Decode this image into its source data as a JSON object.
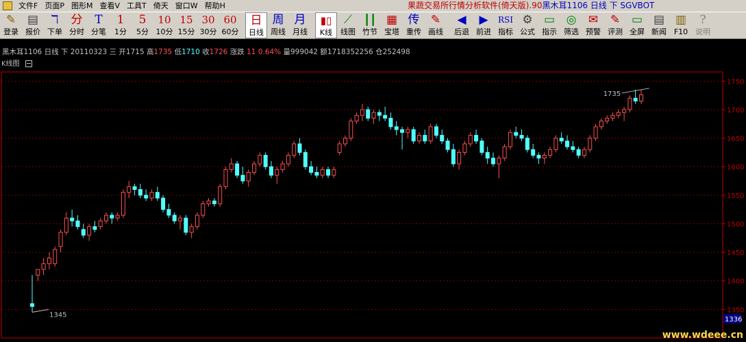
{
  "menu": {
    "items": [
      {
        "label": "文件F",
        "name": "menu-file"
      },
      {
        "label": "页面P",
        "name": "menu-page"
      },
      {
        "label": "图形M",
        "name": "menu-graph"
      },
      {
        "label": "查看V",
        "name": "menu-view"
      },
      {
        "label": "工具T",
        "name": "menu-tools"
      },
      {
        "label": "倚天",
        "name": "menu-yitian"
      },
      {
        "label": "窗口W",
        "name": "menu-window"
      },
      {
        "label": "帮助H",
        "name": "menu-help"
      }
    ],
    "title_prefix": "果蔬交易所行情分析软件(倚天版).90",
    "title_symbol": "黑木耳1106 日线 下 SGVBOT"
  },
  "toolbar": [
    {
      "icon": "✎",
      "label": "登录",
      "name": "login-button",
      "color": "#806000"
    },
    {
      "icon": "▤",
      "label": "报价",
      "name": "quote-button",
      "color": "#404040"
    },
    {
      "icon": "ℸ",
      "label": "下单",
      "name": "order-button",
      "color": "#0000c0"
    },
    {
      "icon": "分",
      "label": "分时",
      "name": "timeshare-button",
      "color": "#c00000"
    },
    {
      "icon": "T",
      "label": "分笔",
      "name": "tick-button",
      "color": "#0000c0"
    },
    {
      "icon": "1",
      "label": "1分",
      "name": "1min-button",
      "color": "#c00000"
    },
    {
      "icon": "5",
      "label": "5分",
      "name": "5min-button",
      "color": "#c00000"
    },
    {
      "icon": "10",
      "label": "10分",
      "name": "10min-button",
      "color": "#c00000"
    },
    {
      "icon": "15",
      "label": "15分",
      "name": "15min-button",
      "color": "#c00000"
    },
    {
      "icon": "30",
      "label": "30分",
      "name": "30min-button",
      "color": "#c00000"
    },
    {
      "icon": "60",
      "label": "60分",
      "name": "60min-button",
      "color": "#c00000"
    },
    {
      "icon": "日",
      "label": "日线",
      "name": "daily-button",
      "color": "#c00000",
      "active": true
    },
    {
      "icon": "周",
      "label": "周线",
      "name": "weekly-button",
      "color": "#0000c0"
    },
    {
      "icon": "月",
      "label": "月线",
      "name": "monthly-button",
      "color": "#0000c0"
    },
    {
      "icon": "▮▯",
      "label": "K线",
      "name": "kline-button",
      "color": "#c00000",
      "active": true
    },
    {
      "icon": "⟋",
      "label": "线图",
      "name": "linechart-button",
      "color": "#008000"
    },
    {
      "icon": "┃┃",
      "label": "竹节",
      "name": "bamboo-button",
      "color": "#008000"
    },
    {
      "icon": "▦",
      "label": "宝塔",
      "name": "pagoda-button",
      "color": "#c00000"
    },
    {
      "icon": "传",
      "label": "重传",
      "name": "reload-button",
      "color": "#0000c0"
    },
    {
      "icon": "✎",
      "label": "画线",
      "name": "draw-line-button",
      "color": "#c00000"
    },
    {
      "icon": "◀",
      "label": "后退",
      "name": "back-button",
      "color": "#0000c0"
    },
    {
      "icon": "▶",
      "label": "前进",
      "name": "forward-button",
      "color": "#0000c0"
    },
    {
      "icon": "RSI",
      "label": "指标",
      "name": "indicator-button",
      "color": "#0000c0"
    },
    {
      "icon": "⚙",
      "label": "公式",
      "name": "formula-button",
      "color": "#404040"
    },
    {
      "icon": "▭",
      "label": "指示",
      "name": "indicate-button",
      "color": "#008000"
    },
    {
      "icon": "◎",
      "label": "筛选",
      "name": "filter-button",
      "color": "#008000"
    },
    {
      "icon": "✉",
      "label": "预警",
      "name": "alert-button",
      "color": "#c00000"
    },
    {
      "icon": "✎",
      "label": "评测",
      "name": "evaluate-button",
      "color": "#c00000"
    },
    {
      "icon": "▭",
      "label": "全屏",
      "name": "fullscreen-button",
      "color": "#008000"
    },
    {
      "icon": "▤",
      "label": "新闻",
      "name": "news-button",
      "color": "#404040"
    },
    {
      "icon": "▥",
      "label": "F10",
      "name": "f10-button",
      "color": "#806000"
    },
    {
      "icon": "?",
      "label": "说明",
      "name": "help-button",
      "color": "#808080",
      "disabled": true
    }
  ],
  "info": {
    "symbol": "黑木耳1106",
    "period": "日线",
    "type": "下",
    "date": "20110323",
    "weekday": "三",
    "open_label": "开",
    "open": "1715",
    "high_label": "高",
    "high": "1735",
    "low_label": "低",
    "low": "1710",
    "close_label": "收",
    "close": "1726",
    "change_label": "涨跌",
    "change": "11",
    "change_pct": "0.64%",
    "volume_label": "量",
    "volume": "999042",
    "amount_label": "额",
    "amount": "1718352256",
    "oi_label": "仓",
    "oi": "252498"
  },
  "panel": {
    "title": "K线图"
  },
  "colors": {
    "up": "#ff5050",
    "down": "#50ffff",
    "grid": "#800000",
    "axis": "#c00000",
    "label": "#c0c0c0"
  },
  "chart_data": {
    "type": "candlestick",
    "ylim": [
      1336,
      1766
    ],
    "yticks": [
      1350,
      1400,
      1450,
      1500,
      1550,
      1600,
      1650,
      1700,
      1750
    ],
    "annotations": [
      {
        "text": "1345",
        "value": 1345
      },
      {
        "text": "1735",
        "value": 1735
      }
    ],
    "cursor_label": "1336",
    "candles": [
      [
        1360,
        1410,
        1345,
        1355
      ],
      [
        1410,
        1420,
        1400,
        1420
      ],
      [
        1420,
        1440,
        1410,
        1430
      ],
      [
        1430,
        1450,
        1420,
        1440
      ],
      [
        1430,
        1460,
        1425,
        1455
      ],
      [
        1460,
        1490,
        1450,
        1485
      ],
      [
        1485,
        1520,
        1480,
        1510
      ],
      [
        1510,
        1525,
        1495,
        1505
      ],
      [
        1505,
        1515,
        1490,
        1495
      ],
      [
        1490,
        1500,
        1475,
        1480
      ],
      [
        1480,
        1500,
        1470,
        1495
      ],
      [
        1495,
        1505,
        1485,
        1490
      ],
      [
        1495,
        1510,
        1490,
        1505
      ],
      [
        1505,
        1520,
        1500,
        1515
      ],
      [
        1515,
        1520,
        1500,
        1510
      ],
      [
        1510,
        1520,
        1505,
        1515
      ],
      [
        1515,
        1560,
        1510,
        1555
      ],
      [
        1555,
        1575,
        1545,
        1565
      ],
      [
        1565,
        1570,
        1550,
        1560
      ],
      [
        1560,
        1570,
        1545,
        1550
      ],
      [
        1550,
        1560,
        1540,
        1545
      ],
      [
        1545,
        1560,
        1540,
        1555
      ],
      [
        1555,
        1565,
        1540,
        1545
      ],
      [
        1545,
        1550,
        1520,
        1525
      ],
      [
        1525,
        1535,
        1510,
        1515
      ],
      [
        1515,
        1520,
        1500,
        1505
      ],
      [
        1505,
        1515,
        1490,
        1510
      ],
      [
        1510,
        1515,
        1480,
        1485
      ],
      [
        1485,
        1500,
        1475,
        1495
      ],
      [
        1495,
        1520,
        1490,
        1515
      ],
      [
        1515,
        1540,
        1510,
        1535
      ],
      [
        1535,
        1545,
        1530,
        1540
      ],
      [
        1540,
        1545,
        1530,
        1535
      ],
      [
        1535,
        1570,
        1530,
        1565
      ],
      [
        1565,
        1600,
        1560,
        1595
      ],
      [
        1595,
        1615,
        1590,
        1605
      ],
      [
        1605,
        1610,
        1580,
        1585
      ],
      [
        1585,
        1600,
        1570,
        1575
      ],
      [
        1575,
        1595,
        1565,
        1590
      ],
      [
        1590,
        1610,
        1585,
        1605
      ],
      [
        1605,
        1625,
        1600,
        1620
      ],
      [
        1620,
        1625,
        1595,
        1600
      ],
      [
        1600,
        1610,
        1580,
        1585
      ],
      [
        1585,
        1600,
        1570,
        1595
      ],
      [
        1595,
        1610,
        1590,
        1605
      ],
      [
        1605,
        1625,
        1600,
        1620
      ],
      [
        1620,
        1645,
        1615,
        1640
      ],
      [
        1640,
        1650,
        1620,
        1625
      ],
      [
        1625,
        1630,
        1595,
        1600
      ],
      [
        1600,
        1610,
        1585,
        1590
      ],
      [
        1590,
        1600,
        1580,
        1585
      ],
      [
        1585,
        1600,
        1580,
        1595
      ],
      [
        1595,
        1600,
        1580,
        1585
      ],
      [
        1585,
        1600,
        1580,
        1595
      ],
      [
        1625,
        1645,
        1620,
        1640
      ],
      [
        1640,
        1655,
        1635,
        1650
      ],
      [
        1650,
        1685,
        1645,
        1680
      ],
      [
        1680,
        1695,
        1675,
        1690
      ],
      [
        1690,
        1710,
        1680,
        1700
      ],
      [
        1700,
        1705,
        1680,
        1685
      ],
      [
        1685,
        1700,
        1675,
        1695
      ],
      [
        1695,
        1700,
        1680,
        1690
      ],
      [
        1690,
        1705,
        1680,
        1685
      ],
      [
        1685,
        1695,
        1665,
        1670
      ],
      [
        1670,
        1680,
        1655,
        1665
      ],
      [
        1665,
        1670,
        1630,
        1660
      ],
      [
        1660,
        1670,
        1650,
        1665
      ],
      [
        1665,
        1670,
        1640,
        1645
      ],
      [
        1645,
        1660,
        1640,
        1655
      ],
      [
        1655,
        1665,
        1640,
        1645
      ],
      [
        1645,
        1675,
        1640,
        1670
      ],
      [
        1670,
        1675,
        1650,
        1655
      ],
      [
        1655,
        1665,
        1640,
        1645
      ],
      [
        1645,
        1650,
        1625,
        1630
      ],
      [
        1630,
        1640,
        1600,
        1605
      ],
      [
        1605,
        1630,
        1595,
        1625
      ],
      [
        1625,
        1645,
        1620,
        1640
      ],
      [
        1640,
        1660,
        1635,
        1655
      ],
      [
        1655,
        1665,
        1640,
        1645
      ],
      [
        1645,
        1650,
        1620,
        1625
      ],
      [
        1625,
        1635,
        1605,
        1615
      ],
      [
        1615,
        1625,
        1600,
        1605
      ],
      [
        1605,
        1620,
        1580,
        1615
      ],
      [
        1615,
        1640,
        1610,
        1635
      ],
      [
        1635,
        1665,
        1630,
        1660
      ],
      [
        1660,
        1670,
        1650,
        1655
      ],
      [
        1655,
        1665,
        1645,
        1650
      ],
      [
        1650,
        1655,
        1625,
        1630
      ],
      [
        1630,
        1640,
        1615,
        1620
      ],
      [
        1620,
        1625,
        1605,
        1615
      ],
      [
        1615,
        1625,
        1605,
        1620
      ],
      [
        1620,
        1635,
        1615,
        1630
      ],
      [
        1630,
        1655,
        1625,
        1650
      ],
      [
        1650,
        1660,
        1640,
        1645
      ],
      [
        1645,
        1655,
        1630,
        1635
      ],
      [
        1635,
        1645,
        1625,
        1630
      ],
      [
        1630,
        1635,
        1615,
        1620
      ],
      [
        1620,
        1635,
        1615,
        1630
      ],
      [
        1630,
        1655,
        1625,
        1650
      ],
      [
        1650,
        1675,
        1645,
        1670
      ],
      [
        1670,
        1685,
        1665,
        1680
      ],
      [
        1680,
        1690,
        1675,
        1685
      ],
      [
        1685,
        1695,
        1680,
        1690
      ],
      [
        1690,
        1700,
        1685,
        1695
      ],
      [
        1695,
        1705,
        1680,
        1700
      ],
      [
        1700,
        1725,
        1695,
        1720
      ],
      [
        1720,
        1735,
        1710,
        1715
      ],
      [
        1715,
        1735,
        1710,
        1726
      ]
    ]
  }
}
